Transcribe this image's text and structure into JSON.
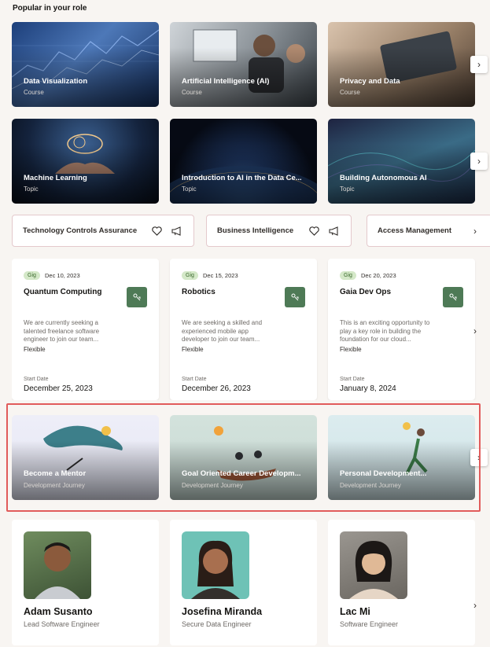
{
  "section": {
    "title": "Popular in your role"
  },
  "courses": [
    {
      "title": "Data Visualization",
      "type": "Course"
    },
    {
      "title": "Artificial Intelligence (AI)",
      "type": "Course"
    },
    {
      "title": "Privacy and Data",
      "type": "Course"
    }
  ],
  "topics": [
    {
      "title": "Machine Learning",
      "type": "Topic"
    },
    {
      "title": "Introduction to AI in the Data Ce...",
      "type": "Topic"
    },
    {
      "title": "Building Autonomous AI",
      "type": "Topic"
    }
  ],
  "chips": [
    {
      "label": "Technology Controls Assurance"
    },
    {
      "label": "Business Intelligence"
    },
    {
      "label": "Access Management"
    }
  ],
  "gigs": [
    {
      "badge": "Gig",
      "date": "Dec 10, 2023",
      "title": "Quantum Computing",
      "description": "We are currently seeking a talented freelance software engineer to join our team...",
      "schedule": "Flexible",
      "start_label": "Start Date",
      "start_date": "December 25, 2023"
    },
    {
      "badge": "Gig",
      "date": "Dec 15, 2023",
      "title": "Robotics",
      "description": "We are seeking a skilled and experienced mobile app developer to join our team...",
      "schedule": "Flexible",
      "start_label": "Start Date",
      "start_date": "December 26, 2023"
    },
    {
      "badge": "Gig",
      "date": "Dec 20, 2023",
      "title": "Gaia Dev Ops",
      "description": "This is an exciting opportunity to play a key role in building the foundation for our cloud...",
      "schedule": "Flexible",
      "start_label": "Start Date",
      "start_date": "January 8, 2024"
    }
  ],
  "journeys": [
    {
      "title": "Become a Mentor",
      "type": "Development Journey"
    },
    {
      "title": "Goal Oriented Career Developm...",
      "type": "Development Journey"
    },
    {
      "title": "Personal Development...",
      "type": "Development Journey"
    }
  ],
  "people": [
    {
      "name": "Adam Susanto",
      "role": "Lead Software Engineer"
    },
    {
      "name": "Josefina Miranda",
      "role": "Secure Data Engineer"
    },
    {
      "name": "Lac Mi",
      "role": "Software Engineer"
    }
  ],
  "icons": {
    "next": "chevron-right-icon",
    "favorite": "heart-icon",
    "share": "megaphone-icon",
    "gig": "gig-icon"
  },
  "colors": {
    "highlight": "#e15b5b",
    "gig_icon_bg": "#4e7a56",
    "badge_bg": "#d4e8c8"
  }
}
